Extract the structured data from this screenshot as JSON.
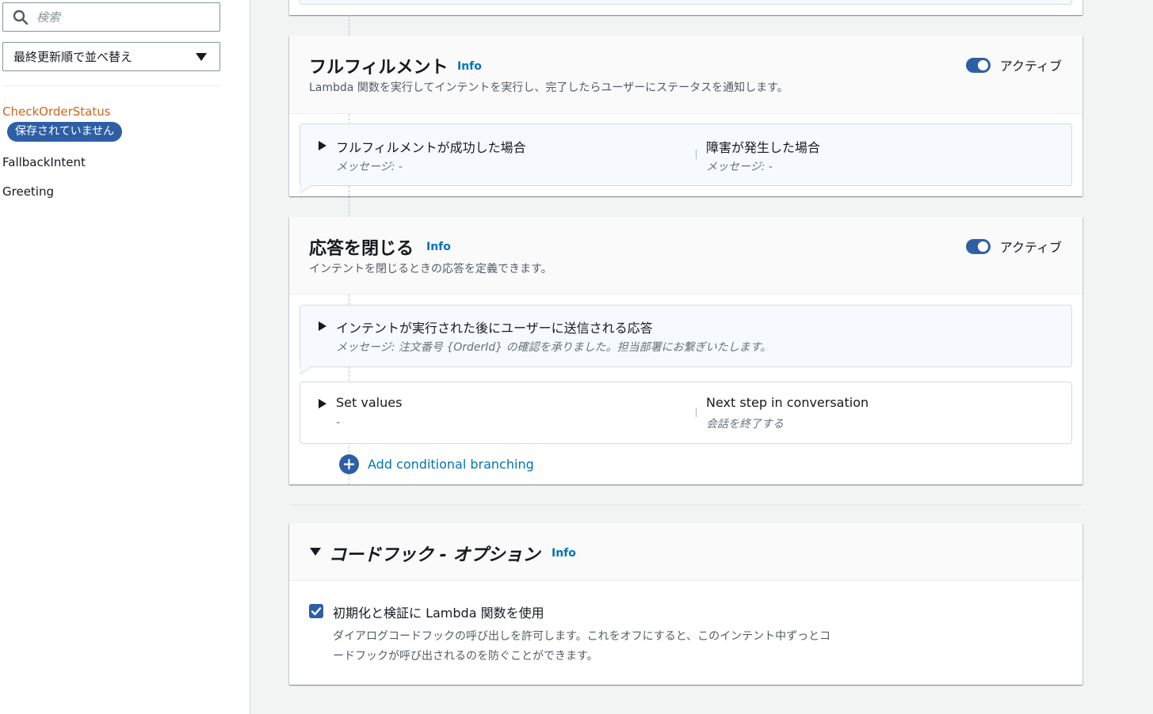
{
  "sidebar": {
    "search_placeholder": "検索",
    "sort_label": "最終更新順で並べ替え",
    "intents": [
      {
        "name": "CheckOrderStatus",
        "badge": "保存されていません"
      },
      {
        "name": "FallbackIntent"
      },
      {
        "name": "Greeting"
      }
    ]
  },
  "fulfillment": {
    "title": "フルフィルメント",
    "info": "Info",
    "description": "Lambda 関数を実行してインテントを実行し、完了したらユーザーにステータスを通知します。",
    "toggle_label": "アクティブ",
    "success_label": "フルフィルメントが成功した場合",
    "success_message": "メッセージ: -",
    "failure_label": "障害が発生した場合",
    "failure_message": "メッセージ: -"
  },
  "closing": {
    "title": "応答を閉じる",
    "info": "Info",
    "description": "インテントを閉じるときの応答を定義できます。",
    "toggle_label": "アクティブ",
    "response_label": "インテントが実行された後にユーザーに送信される応答",
    "response_message": "メッセージ: 注文番号 {OrderId} の確認を承りました。担当部署にお繋ぎいたします。",
    "set_values_label": "Set values",
    "set_values_value": "-",
    "next_step_label": "Next step in conversation",
    "next_step_value": "会話を終了する",
    "add_branching": "Add conditional branching"
  },
  "codehook": {
    "title": "コードフック - オプション",
    "info": "Info",
    "checkbox_label": "初期化と検証に Lambda 関数を使用",
    "help_line1": "ダイアログコードフックの呼び出しを許可します。これをオフにすると、このインテント中ずっとコ",
    "help_line2": "ードフックが呼び出されるのを防ぐことができます。"
  }
}
